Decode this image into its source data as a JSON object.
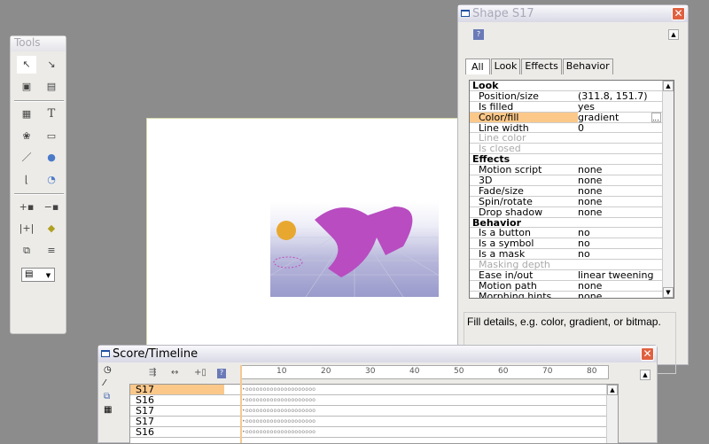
{
  "tools_palette": {
    "title": "Tools",
    "tools": [
      "arrow-select",
      "direct-select",
      "import-image",
      "import-media",
      "text-box",
      "text",
      "symbol",
      "button",
      "line",
      "ellipse",
      "shape",
      "freeform",
      "add-point",
      "remove-point",
      "fit",
      "eraser",
      "group",
      "align",
      "color-picker"
    ]
  },
  "shape_panel": {
    "title": "Shape S17",
    "tabs": [
      "All",
      "Look",
      "Effects",
      "Behavior"
    ],
    "rows": [
      {
        "type": "header",
        "label": "Look"
      },
      {
        "label": "Position/size",
        "value": "(311.8, 151.7)"
      },
      {
        "label": "Is filled",
        "value": "yes"
      },
      {
        "label": "Color/fill",
        "value": "gradient",
        "selected": true
      },
      {
        "label": "Line width",
        "value": "0"
      },
      {
        "label": "Line color",
        "value": "",
        "disabled": true
      },
      {
        "label": "Is closed",
        "value": "",
        "disabled": true
      },
      {
        "type": "header",
        "label": "Effects"
      },
      {
        "label": "Motion script",
        "value": "none"
      },
      {
        "label": "3D",
        "value": "none"
      },
      {
        "label": "Fade/size",
        "value": "none"
      },
      {
        "label": "Spin/rotate",
        "value": "none"
      },
      {
        "label": "Drop shadow",
        "value": "none"
      },
      {
        "type": "header",
        "label": "Behavior"
      },
      {
        "label": "Is a button",
        "value": "no"
      },
      {
        "label": "Is a symbol",
        "value": "no"
      },
      {
        "label": "Is a mask",
        "value": "no"
      },
      {
        "label": "Masking depth",
        "value": "",
        "disabled": true
      },
      {
        "label": "Ease in/out",
        "value": "linear tweening"
      },
      {
        "label": "Motion path",
        "value": "none"
      },
      {
        "label": "Morphing hints",
        "value": "none"
      }
    ],
    "help_text": "Fill details, e.g. color, gradient, or bitmap.",
    "ellipsis": "..."
  },
  "timeline": {
    "title": "Score/Timeline",
    "ruler_ticks": [
      "10",
      "20",
      "30",
      "40",
      "50",
      "60",
      "70",
      "80"
    ],
    "rows": [
      {
        "name": "S17",
        "selected": true
      },
      {
        "name": "S16"
      },
      {
        "name": "S17"
      },
      {
        "name": "S17"
      },
      {
        "name": "S16"
      }
    ],
    "dots": "•oooooooooooooooooooo"
  },
  "colors": {
    "selection": "#fbc88a",
    "close": "#e06040"
  }
}
